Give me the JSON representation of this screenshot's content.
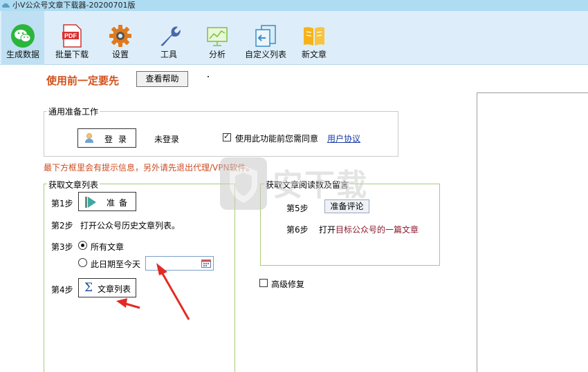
{
  "window": {
    "title": "小V公众号文章下载器-20200701版"
  },
  "ribbon": {
    "items": [
      {
        "label": "生成数据",
        "icon": "wechat-icon"
      },
      {
        "label": "批量下载",
        "icon": "pdf-icon"
      },
      {
        "label": "设置",
        "icon": "gear-icon"
      },
      {
        "label": "工具",
        "icon": "wrench-icon"
      },
      {
        "label": "分析",
        "icon": "chart-icon"
      },
      {
        "label": "自定义列表",
        "icon": "custom-list-icon"
      },
      {
        "label": "新文章",
        "icon": "book-icon"
      }
    ],
    "active_index": 0
  },
  "header": {
    "warning": "使用前一定要先",
    "help_button": "查看帮助",
    "dot": "."
  },
  "prep": {
    "legend": "通用准备工作",
    "login_button": "登录",
    "login_status": "未登录",
    "agree_checked": true,
    "agree_text": "使用此功能前您需同意",
    "agree_link": "用户协议"
  },
  "tip": "最下方框里会有提示信息，另外请先退出代理/VPN软件。",
  "list_group": {
    "legend": "获取文章列表",
    "step1": "第1步",
    "prep_button": "准备",
    "step2": "第2步",
    "step2_text": "打开公众号历史文章列表。",
    "step3": "第3步",
    "radio_all": "所有文章",
    "radio_all_selected": true,
    "radio_date": "此日期至今天",
    "date_value": "",
    "step4": "第4步",
    "list_button": "文章列表"
  },
  "read_group": {
    "legend": "获取文章阅读数及留言",
    "step5": "第5步",
    "read_button": "准备评论",
    "step6": "第6步",
    "step6_prefix": "打开",
    "step6_highlight": "目标公众号的一篇文章"
  },
  "advanced": {
    "label": "高级修复",
    "checked": false
  },
  "watermark": {
    "text": "安下载"
  },
  "colors": {
    "ribbon_bg": "#ddeefa",
    "warning": "#d2501a",
    "group_border": "#a8cc74",
    "arrow": "#e32a24"
  }
}
